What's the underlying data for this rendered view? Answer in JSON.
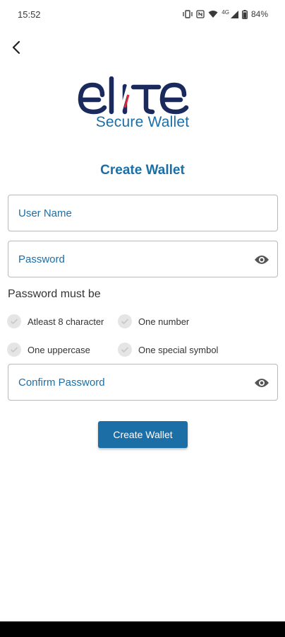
{
  "status_bar": {
    "time": "15:52",
    "network": "4G",
    "battery": "84%",
    "icons": [
      "vibrate-icon",
      "nfc-icon",
      "wifi-icon",
      "signal-icon",
      "battery-icon"
    ]
  },
  "header": {
    "back_icon": "chevron-left-icon"
  },
  "logo": {
    "wordmark": "elite",
    "subtitle": "Secure Wallet"
  },
  "form": {
    "title": "Create Wallet",
    "username": {
      "value": "",
      "placeholder": "User Name"
    },
    "password": {
      "value": "",
      "placeholder": "Password",
      "icon": "eye-icon"
    },
    "rules_heading": "Password must be",
    "rules": [
      {
        "label": "Atleast 8 character",
        "met": false
      },
      {
        "label": "One number",
        "met": false
      },
      {
        "label": "One uppercase",
        "met": false
      },
      {
        "label": "One special symbol",
        "met": false
      }
    ],
    "confirm_password": {
      "value": "",
      "placeholder": "Confirm Password",
      "icon": "eye-icon"
    },
    "submit_label": "Create Wallet"
  },
  "colors": {
    "primary": "#1c6ea6",
    "logo_dark": "#1b2a5c",
    "logo_accent": "#d9283a",
    "check_bg": "#e5e5e5"
  }
}
